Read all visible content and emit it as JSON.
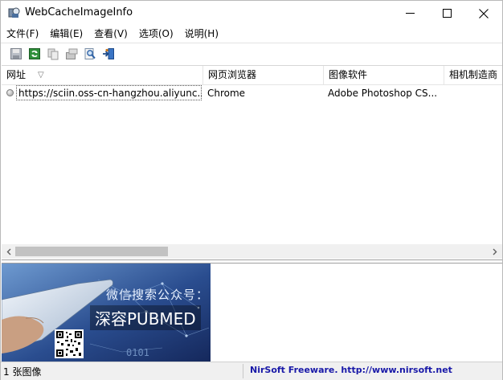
{
  "window": {
    "title": "WebCacheImageInfo"
  },
  "menu": [
    "文件(F)",
    "编辑(E)",
    "查看(V)",
    "选项(O)",
    "说明(H)"
  ],
  "toolbar": [
    "save-icon",
    "refresh-icon",
    "copy-icon",
    "properties-icon",
    "find-icon",
    "exit-icon"
  ],
  "columns": [
    "网址",
    "网页浏览器",
    "图像软件",
    "相机制造商"
  ],
  "sort_indicator": "▽",
  "rows": [
    {
      "url": "https://sciin.oss-cn-hangzhou.aliyunc...",
      "browser": "Chrome",
      "software": "Adobe Photoshop CS...",
      "camera": ""
    }
  ],
  "preview": {
    "line1": "微信搜索公众号：",
    "line2": "深容PUBMED",
    "digits": "0101",
    "colors": {
      "bg_dark": "#1c3470",
      "bg_light": "#5d88bf"
    }
  },
  "status": {
    "count": "1 张图像",
    "credit": "NirSoft Freeware.  http://www.nirsoft.net"
  }
}
